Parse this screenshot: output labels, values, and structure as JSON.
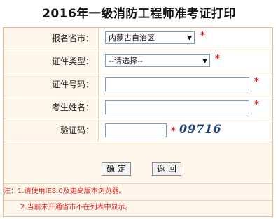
{
  "page": {
    "title": "2016年一级消防工程师准考证打印"
  },
  "form": {
    "province_label": "报名省市：",
    "province_value": "内蒙古自治区",
    "idtype_label": "证件类型：",
    "idtype_value": "--请选择--",
    "idnum_label": "证件号码：",
    "idnum_value": "",
    "name_label": "考生姓名：",
    "name_value": "",
    "captcha_label": "验证码：",
    "captcha_value": "",
    "captcha_text": "09716",
    "required_mark": "*"
  },
  "buttons": {
    "confirm": "确定",
    "back": "返回"
  },
  "notes": {
    "line1": "注：1.请使用IE8.0及更高版本浏览器。",
    "line2": "2.当前未开通省市不在列表中显示。"
  },
  "icons": {
    "dropdown": "chevron-down-icon"
  },
  "colors": {
    "border": "#e6b98a",
    "label_bg": "#fff6ec",
    "required": "#e02020"
  }
}
